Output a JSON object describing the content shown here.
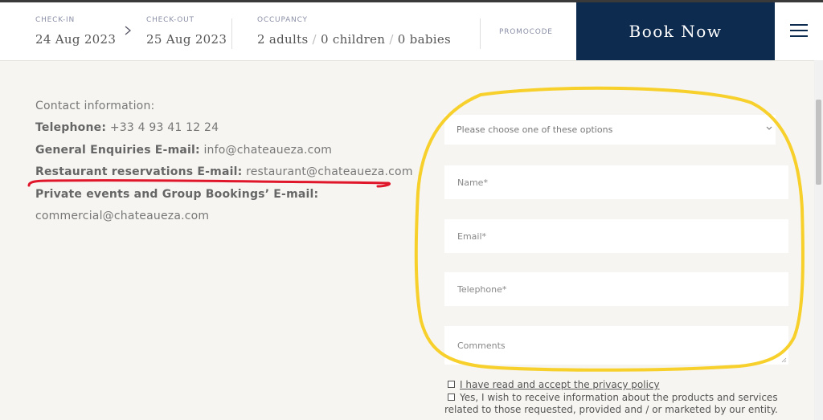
{
  "booking_bar": {
    "checkin_label": "CHECK-IN",
    "checkin_value": "24 Aug 2023",
    "checkout_label": "CHECK-OUT",
    "checkout_value": "25 Aug 2023",
    "occupancy_label": "OCCUPANCY",
    "adults": "2 adults",
    "children": "0 children",
    "babies": "0 babies",
    "occupancy_separator": "/",
    "promocode_label": "PROMOCODE",
    "book_button": "Book Now"
  },
  "contact": {
    "heading": "Contact information:",
    "telephone_label": "Telephone:",
    "telephone_value": "+33 4 93 41 12 24",
    "general_label": "General Enquiries E-mail:",
    "general_value": "info@chateaueza.com",
    "restaurant_label": "Restaurant reservations E-mail:",
    "restaurant_value": "restaurant@chateaueza.com",
    "private_label": "Private events and Group Bookings’ E-mail:",
    "private_value": "commercial@chateaueza.com"
  },
  "form": {
    "select_placeholder": "Please choose one of these options",
    "name_placeholder": "Name*",
    "email_placeholder": "Email*",
    "telephone_placeholder": "Telephone*",
    "comments_placeholder": "Comments",
    "privacy_label": "I have read and accept the privacy policy",
    "marketing_line1": "Yes, I wish to receive information about the products and services",
    "marketing_line2": "related to those requested, provided and / or marketed by our entity."
  },
  "colors": {
    "brand_navy": "#0d2b4f",
    "page_bg": "#f6f5f1",
    "annotation_red": "#e0162b",
    "annotation_yellow": "#f7d02c"
  },
  "icons": [
    "chevron-right-icon",
    "hamburger-menu-icon",
    "chevron-down-icon",
    "resize-grip-icon"
  ]
}
